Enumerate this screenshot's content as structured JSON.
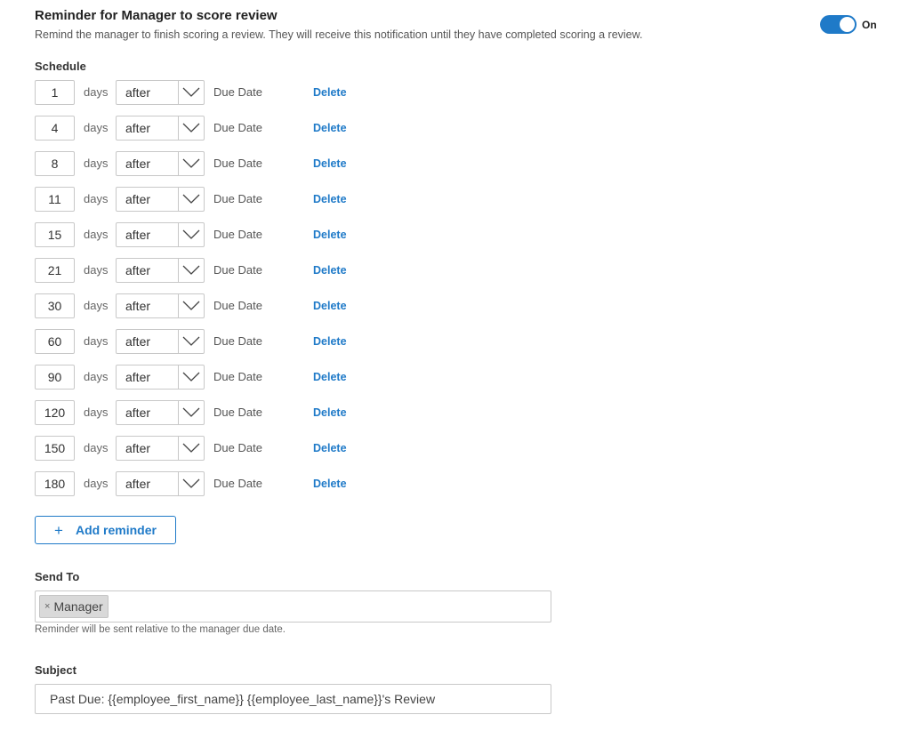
{
  "reminder": {
    "title": "Reminder for Manager to score review",
    "description": "Remind the manager to finish scoring a review. They will receive this notification until they have completed scoring a review.",
    "toggle_label": "On",
    "toggle_on": true
  },
  "schedule": {
    "label": "Schedule",
    "rows": [
      {
        "days": "1",
        "unit": "days",
        "relation": "after",
        "anchor": "Due Date",
        "action": "Delete"
      },
      {
        "days": "4",
        "unit": "days",
        "relation": "after",
        "anchor": "Due Date",
        "action": "Delete"
      },
      {
        "days": "8",
        "unit": "days",
        "relation": "after",
        "anchor": "Due Date",
        "action": "Delete"
      },
      {
        "days": "11",
        "unit": "days",
        "relation": "after",
        "anchor": "Due Date",
        "action": "Delete"
      },
      {
        "days": "15",
        "unit": "days",
        "relation": "after",
        "anchor": "Due Date",
        "action": "Delete"
      },
      {
        "days": "21",
        "unit": "days",
        "relation": "after",
        "anchor": "Due Date",
        "action": "Delete"
      },
      {
        "days": "30",
        "unit": "days",
        "relation": "after",
        "anchor": "Due Date",
        "action": "Delete"
      },
      {
        "days": "60",
        "unit": "days",
        "relation": "after",
        "anchor": "Due Date",
        "action": "Delete"
      },
      {
        "days": "90",
        "unit": "days",
        "relation": "after",
        "anchor": "Due Date",
        "action": "Delete"
      },
      {
        "days": "120",
        "unit": "days",
        "relation": "after",
        "anchor": "Due Date",
        "action": "Delete"
      },
      {
        "days": "150",
        "unit": "days",
        "relation": "after",
        "anchor": "Due Date",
        "action": "Delete"
      },
      {
        "days": "180",
        "unit": "days",
        "relation": "after",
        "anchor": "Due Date",
        "action": "Delete"
      }
    ],
    "add_label": "Add reminder"
  },
  "send_to": {
    "label": "Send To",
    "recipients": [
      "Manager"
    ],
    "remove_icon": "×",
    "hint": "Reminder will be sent relative to the manager due date."
  },
  "subject": {
    "label": "Subject",
    "value": "Past Due: {{employee_first_name}} {{employee_last_name}}'s Review"
  },
  "colors": {
    "accent": "#1f7ac8",
    "border": "#c8c8c8",
    "tag_bg": "#d9d9d9"
  }
}
